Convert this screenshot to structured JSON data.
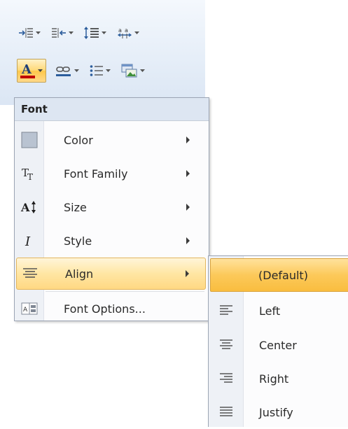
{
  "toolbar": {
    "row1": [
      {
        "name": "increase-indent-icon"
      },
      {
        "name": "decrease-indent-icon"
      },
      {
        "name": "line-spacing-icon"
      },
      {
        "name": "character-spacing-icon"
      }
    ],
    "row2": [
      {
        "name": "font-color-icon",
        "letter": "A",
        "underline_color": "#c00000",
        "active": true
      },
      {
        "name": "hyperlink-icon"
      },
      {
        "name": "bullet-list-icon"
      },
      {
        "name": "picture-icon"
      }
    ]
  },
  "menu": {
    "header": "Font",
    "items": [
      {
        "label": "Color",
        "icon": "color-swatch-icon",
        "has_submenu": true
      },
      {
        "label": "Font Family",
        "icon": "font-family-icon",
        "has_submenu": true
      },
      {
        "label": "Size",
        "icon": "font-size-icon",
        "has_submenu": true
      },
      {
        "label": "Style",
        "icon": "italic-icon",
        "has_submenu": true
      },
      {
        "label": "Align",
        "icon": "align-icon",
        "has_submenu": true,
        "highlighted": true
      },
      {
        "label": "Font Options...",
        "icon": "font-options-icon",
        "has_submenu": false
      }
    ]
  },
  "submenu": {
    "items": [
      {
        "label": "(Default)",
        "icon": "",
        "selected": true
      },
      {
        "label": "Left",
        "icon": "align-left-icon"
      },
      {
        "label": "Center",
        "icon": "align-center-icon"
      },
      {
        "label": "Right",
        "icon": "align-right-icon"
      },
      {
        "label": "Justify",
        "icon": "align-justify-icon"
      }
    ]
  },
  "colors": {
    "highlight": "#ffd883",
    "selected": "#fcc95a",
    "menu_header": "#dde6f2",
    "swatch": "#b9c3d1"
  }
}
